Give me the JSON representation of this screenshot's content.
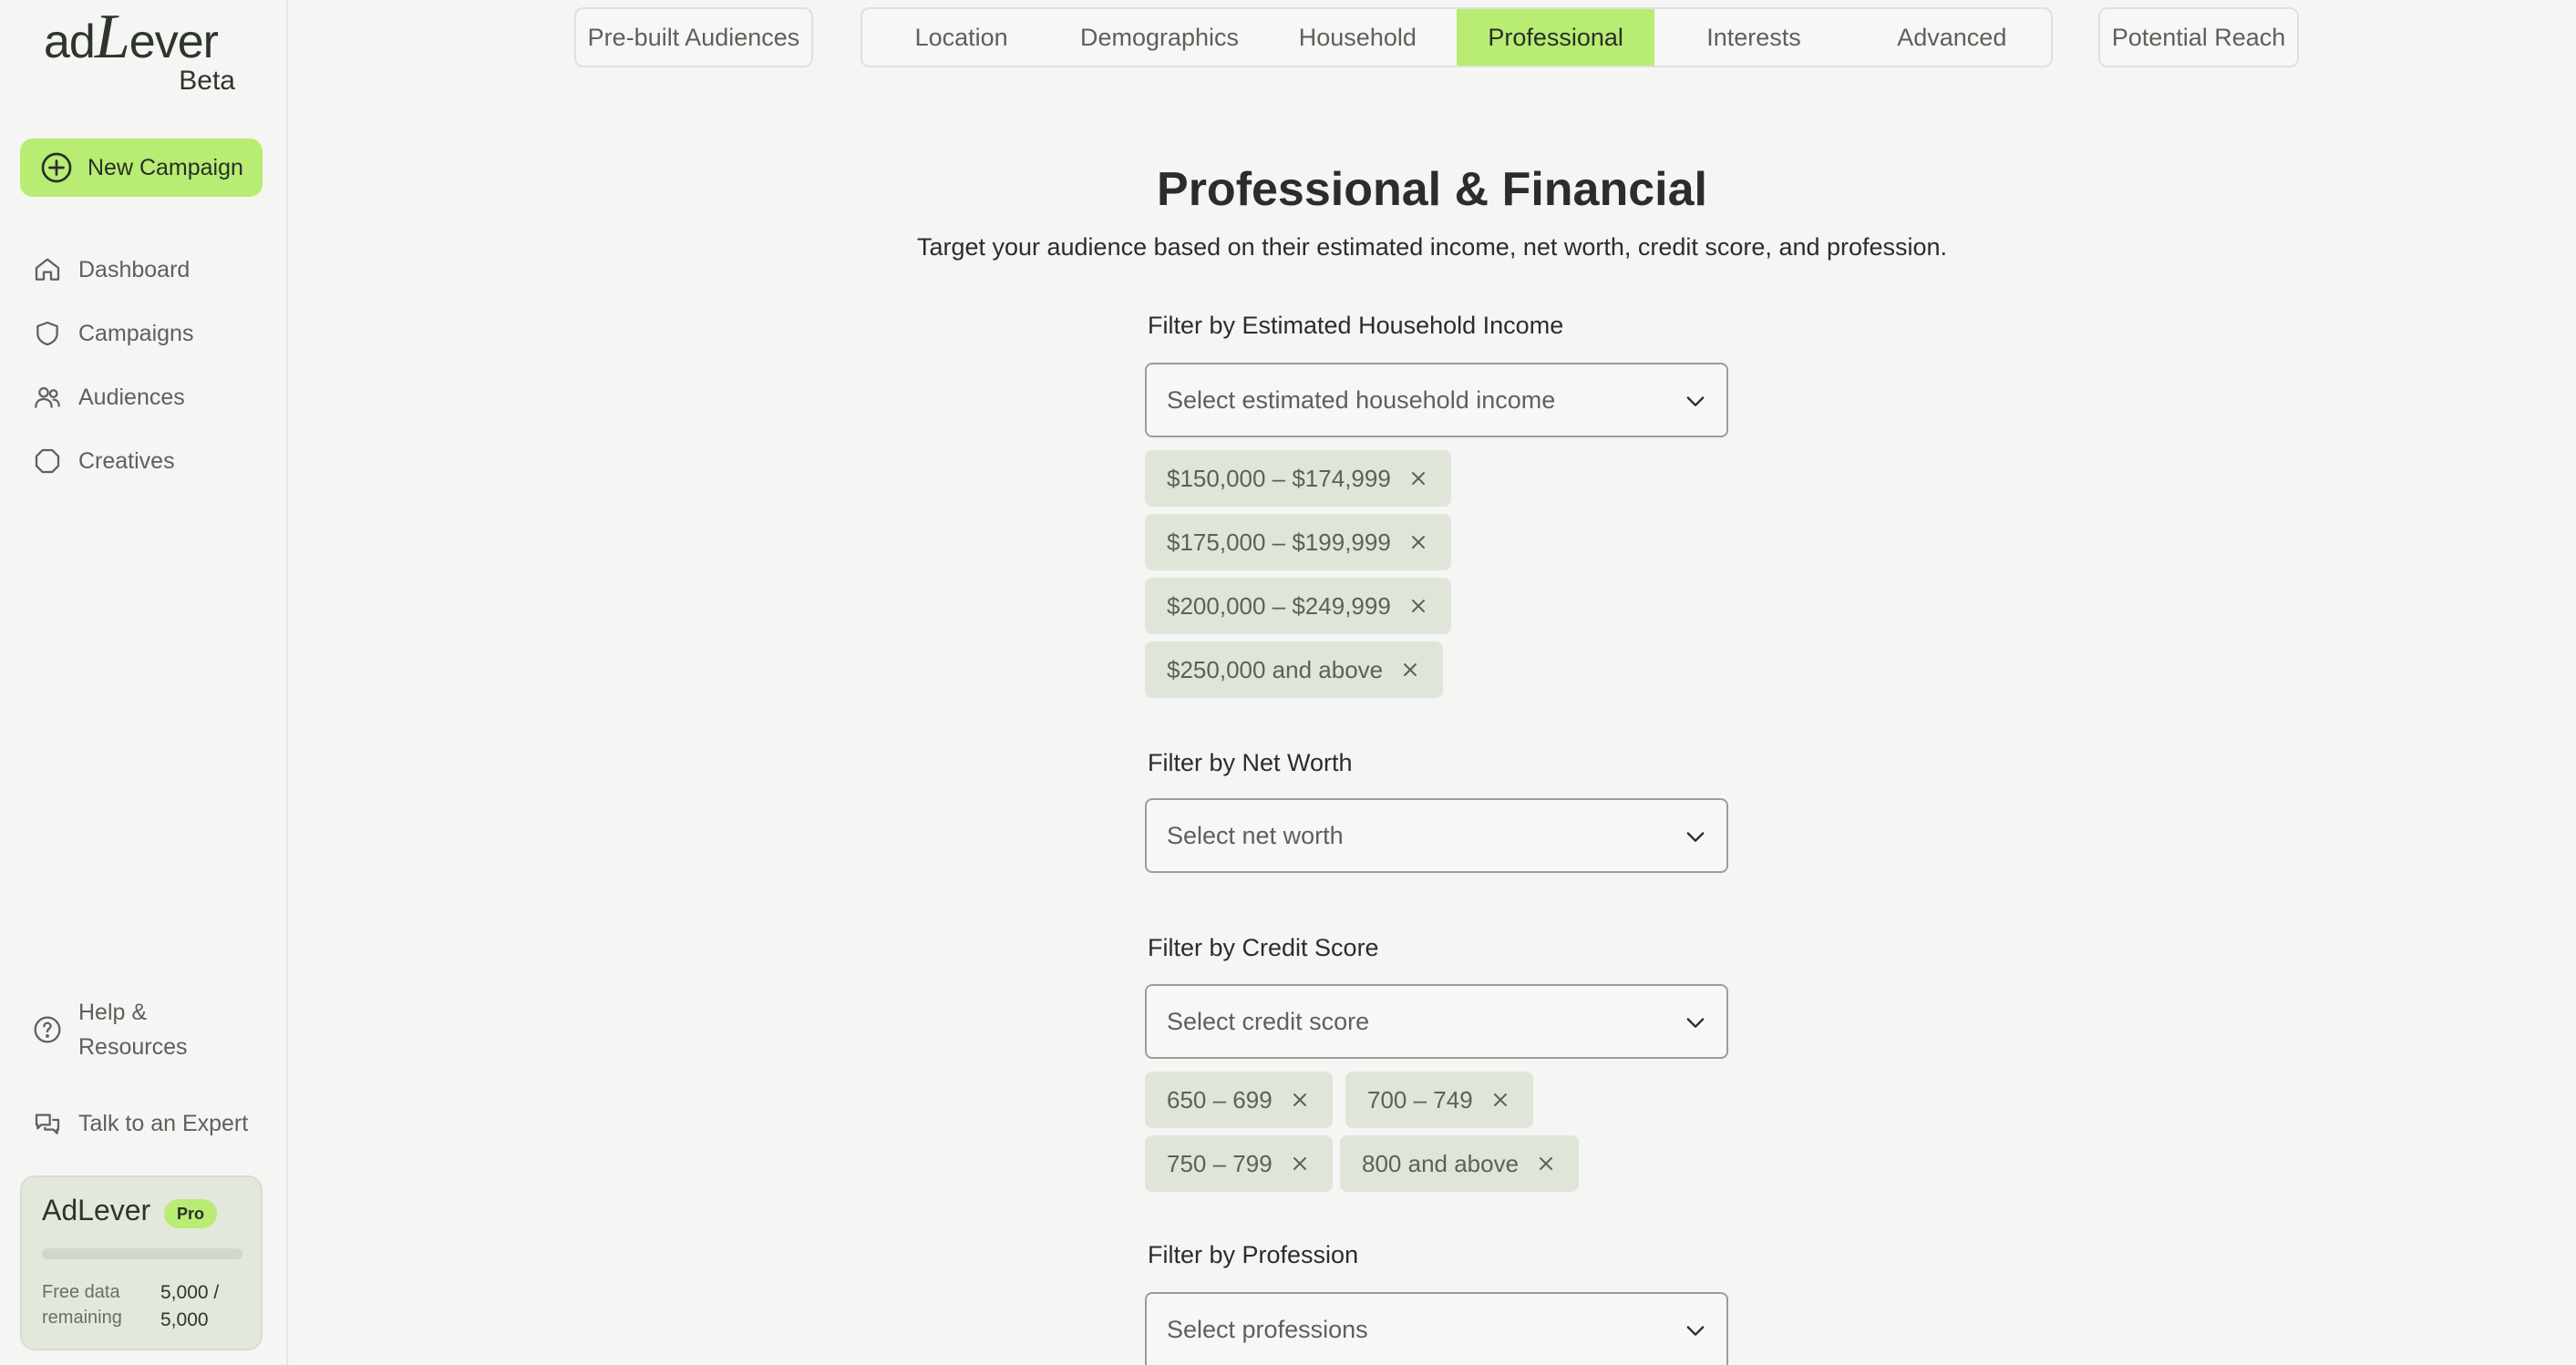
{
  "brand": {
    "name": "adLever",
    "logo_prefix": "ad",
    "logo_letter": "L",
    "logo_suffix": "ever",
    "tag": "Beta"
  },
  "sidebar": {
    "new_campaign": "New Campaign",
    "items": [
      {
        "label": "Dashboard",
        "icon": "home-icon"
      },
      {
        "label": "Campaigns",
        "icon": "shield-icon"
      },
      {
        "label": "Audiences",
        "icon": "users-icon"
      },
      {
        "label": "Creatives",
        "icon": "hexagon-icon"
      }
    ],
    "help_label": "Help & Resources",
    "expert_label": "Talk to an Expert",
    "pro_card": {
      "title": "AdLever",
      "badge": "Pro",
      "usage_fraction": 0,
      "label": "Free data remaining",
      "value": "5,000 / 5,000"
    }
  },
  "tabs": {
    "prebuilt": "Pre-built Audiences",
    "items": [
      "Location",
      "Demographics",
      "Household",
      "Professional",
      "Interests",
      "Advanced"
    ],
    "active": "Professional",
    "reach": "Potential Reach"
  },
  "main": {
    "title": "Professional & Financial",
    "subtitle": "Target your audience based on their estimated income, net worth, credit score, and profession.",
    "income": {
      "label": "Filter by Estimated Household Income",
      "placeholder": "Select estimated household income",
      "chips": [
        "$150,000 – $174,999",
        "$175,000 – $199,999",
        "$200,000 – $249,999",
        "$250,000 and above"
      ]
    },
    "net_worth": {
      "label": "Filter by Net Worth",
      "placeholder": "Select net worth"
    },
    "credit": {
      "label": "Filter by Credit Score",
      "placeholder": "Select credit score",
      "chips": [
        "650 – 699",
        "700 – 749",
        "750 – 799",
        "800 and above"
      ]
    },
    "profession": {
      "label": "Filter by Profession",
      "placeholder": "Select professions"
    }
  },
  "colors": {
    "accent": "#b9ec72",
    "chip": "#dfe5d8",
    "background": "#f5f5f4"
  }
}
